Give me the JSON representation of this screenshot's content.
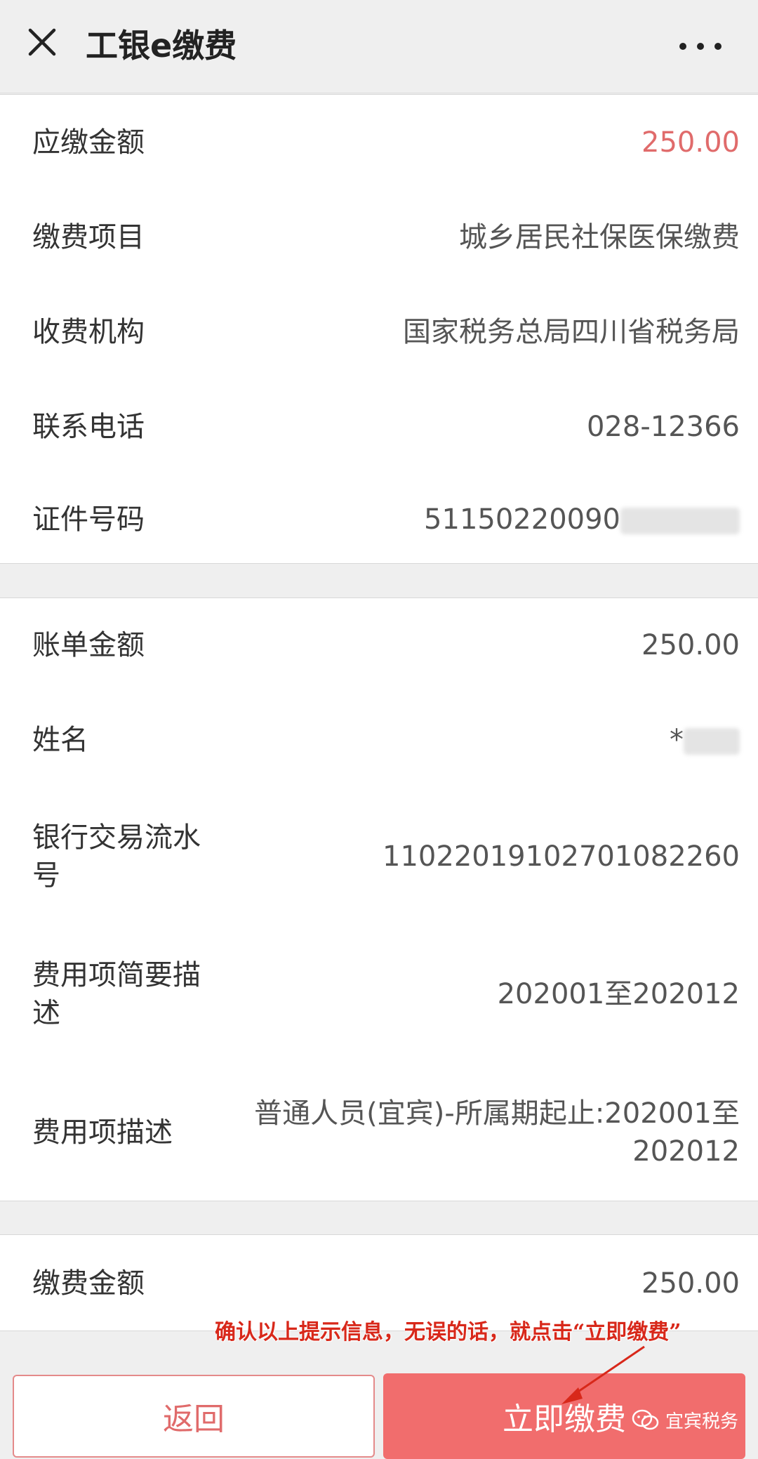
{
  "header": {
    "title": "工银e缴费"
  },
  "summary": {
    "amount_due_label": "应缴金额",
    "amount_due_value": "250.00",
    "item_label": "缴费项目",
    "item_value": "城乡居民社保医保缴费",
    "agency_label": "收费机构",
    "agency_value": "国家税务总局四川省税务局",
    "phone_label": "联系电话",
    "phone_value": "028-12366",
    "id_label": "证件号码",
    "id_value": "51150220090"
  },
  "bill": {
    "bill_amount_label": "账单金额",
    "bill_amount_value": "250.00",
    "name_label": "姓名",
    "name_value": "*",
    "serial_label": "银行交易流水号",
    "serial_value": "11022019102701082260",
    "brief_label": "费用项简要描述",
    "brief_value": "202001至202012",
    "desc_label": "费用项描述",
    "desc_value": "普通人员(宜宾)-所属期起止:202001至202012"
  },
  "payment": {
    "pay_amount_label": "缴费金额",
    "pay_amount_value": "250.00"
  },
  "annotation": {
    "text": "确认以上提示信息，无误的话，就点击“立即缴费”"
  },
  "buttons": {
    "back_label": "返回",
    "pay_label": "立即缴费"
  },
  "watermark": {
    "text": "宜宾税务"
  },
  "colors": {
    "accent": "#f16d6d",
    "amount_due": "#e06b6b",
    "annotation": "#d8281a",
    "background": "#efefef"
  },
  "icons": {
    "close": "close-icon",
    "more": "more-icon",
    "watermark": "wechat-icon"
  }
}
